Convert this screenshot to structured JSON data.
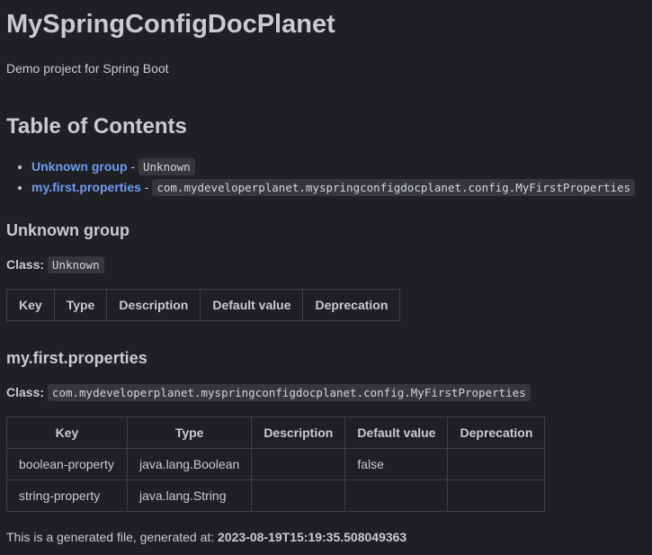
{
  "title": "MySpringConfigDocPlanet",
  "subtitle": "Demo project for Spring Boot",
  "toc": {
    "heading": "Table of Contents",
    "items": [
      {
        "label": "Unknown group",
        "separator": "-",
        "class": "Unknown"
      },
      {
        "label": "my.first.properties",
        "separator": "-",
        "class": "com.mydeveloperplanet.myspringconfigdocplanet.config.MyFirstProperties"
      }
    ]
  },
  "sections": [
    {
      "heading": "Unknown group",
      "class_label": "Class:",
      "class_value": "Unknown",
      "columns": [
        "Key",
        "Type",
        "Description",
        "Default value",
        "Deprecation"
      ],
      "rows": []
    },
    {
      "heading": "my.first.properties",
      "class_label": "Class:",
      "class_value": "com.mydeveloperplanet.myspringconfigdocplanet.config.MyFirstProperties",
      "columns": [
        "Key",
        "Type",
        "Description",
        "Default value",
        "Deprecation"
      ],
      "rows": [
        [
          "boolean-property",
          "java.lang.Boolean",
          "",
          "false",
          ""
        ],
        [
          "string-property",
          "java.lang.String",
          "",
          "",
          ""
        ]
      ]
    }
  ],
  "footer": {
    "text": "This is a generated file, generated at:",
    "timestamp": "2023-08-19T15:19:35.508049363"
  }
}
